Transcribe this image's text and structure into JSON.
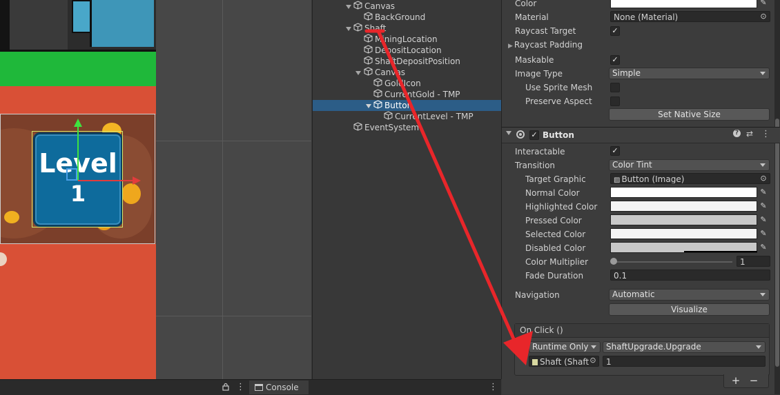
{
  "hierarchy": {
    "items": [
      {
        "label": "Canvas",
        "expanded": true
      },
      {
        "label": "BackGround"
      },
      {
        "label": "Shaft",
        "expanded": true
      },
      {
        "label": "MiningLocation"
      },
      {
        "label": "DepositLocation"
      },
      {
        "label": "ShaftDepositPosition"
      },
      {
        "label": "Canvas",
        "expanded": true
      },
      {
        "label": "GoldIcon"
      },
      {
        "label": "CurrentGold - TMP"
      },
      {
        "label": "Button",
        "expanded": true,
        "selected": true
      },
      {
        "label": "CurrentLevel - TMP"
      },
      {
        "label": "EventSystem"
      }
    ]
  },
  "scene": {
    "button_text_line1": "Level",
    "button_text_line2": "1",
    "colors": {
      "game_bg": "#d95036",
      "grass": "#1fb83a",
      "button": "#0e6b9c"
    }
  },
  "bottom": {
    "console_label": "Console"
  },
  "image_component": {
    "color_label": "Color",
    "material_label": "Material",
    "material_value": "None (Material)",
    "raycast_target_label": "Raycast Target",
    "raycast_padding_label": "Raycast Padding",
    "maskable_label": "Maskable",
    "image_type_label": "Image Type",
    "image_type_value": "Simple",
    "use_sprite_mesh_label": "Use Sprite Mesh",
    "preserve_aspect_label": "Preserve Aspect",
    "set_native_size_label": "Set Native Size"
  },
  "button_component": {
    "title": "Button",
    "interactable_label": "Interactable",
    "transition_label": "Transition",
    "transition_value": "Color Tint",
    "target_graphic_label": "Target Graphic",
    "target_graphic_value": "Button (Image)",
    "normal_color_label": "Normal Color",
    "highlighted_color_label": "Highlighted Color",
    "pressed_color_label": "Pressed Color",
    "selected_color_label": "Selected Color",
    "disabled_color_label": "Disabled Color",
    "color_multiplier_label": "Color Multiplier",
    "color_multiplier_value": "1",
    "fade_duration_label": "Fade Duration",
    "fade_duration_value": "0.1",
    "navigation_label": "Navigation",
    "navigation_value": "Automatic",
    "visualize_label": "Visualize",
    "colors": {
      "normal": "#ffffff",
      "highlighted": "#f5f5f5",
      "pressed": "#c8c8c8",
      "selected": "#f5f5f5",
      "disabled": "#c8c8c8"
    }
  },
  "on_click": {
    "header": "On Click ()",
    "runtime_value": "Runtime Only",
    "function_value": "ShaftUpgrade.Upgrade",
    "object_value": "Shaft (Shaft",
    "argument_value": "1",
    "add_label": "+",
    "remove_label": "−"
  }
}
